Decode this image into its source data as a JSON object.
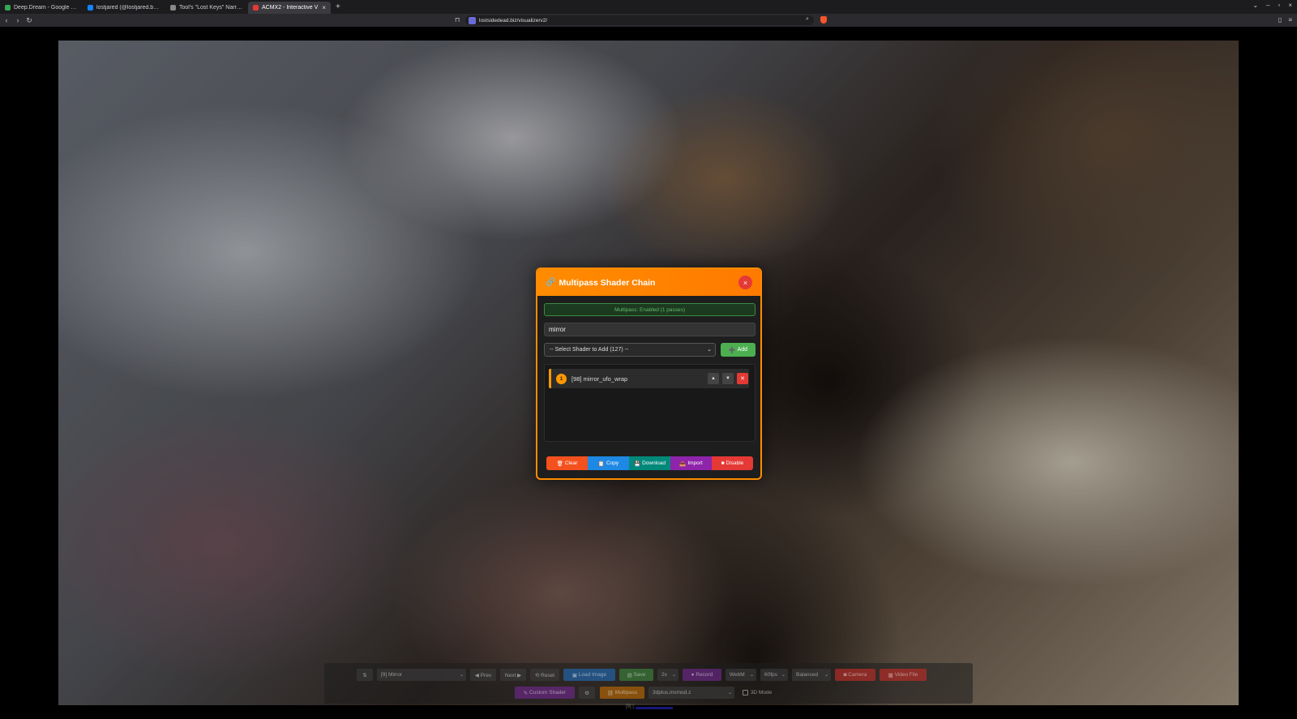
{
  "browser": {
    "tabs": [
      {
        "title": "Deep.Dream - Google Drive",
        "color": "#34a853"
      },
      {
        "title": "lostjared (@lostjared.bsky.s",
        "color": "#1185fe"
      },
      {
        "title": "Tool's \"Lost Keys\" Narrativ",
        "color": "#888888"
      },
      {
        "title": "ACMX2 - Interactive V",
        "color": "#e53935"
      }
    ],
    "new_tab_glyph": "+",
    "url": "lostsidedead.biz/visualizerv2/"
  },
  "modal": {
    "title": "Multipass Shader Chain",
    "close_glyph": "×",
    "status": "Multipass: Enabled (1 passes)",
    "search_value": "mirror",
    "select_label": "-- Select Shader to Add (127) --",
    "add_label": "Add",
    "passes": [
      {
        "index": "1",
        "name": "[98] mirror_ufo_wrap"
      }
    ],
    "footer": {
      "clear": "Clear",
      "copy": "Copy",
      "download": "Download",
      "import": "Import",
      "disable": "Disable"
    }
  },
  "controls": {
    "swap_glyph": "⇅",
    "shader_select": "[9] Mirror",
    "prev": "◀ Prev",
    "next": "Next ▶",
    "reset": "⟲ Reset",
    "load_image": "Load Image",
    "save": "Save",
    "scale": "2x",
    "record": "Record",
    "format": "WebM",
    "fps": "60fps",
    "quality": "Balanced",
    "camera": "Camera",
    "video_file": "Video File",
    "custom_shader": "Custom Shader",
    "settings_glyph": "⚙",
    "multipass": "Multipass",
    "model_select": "3dplus.mxmod.z",
    "mode_3d": "3D Mode",
    "fps_readout": "[9] ["
  }
}
